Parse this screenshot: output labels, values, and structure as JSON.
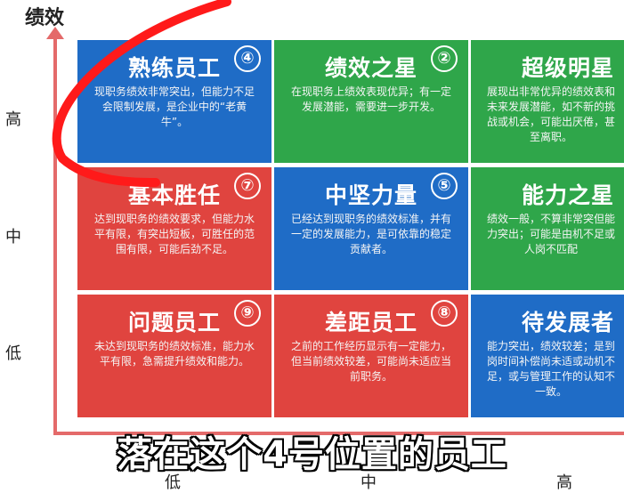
{
  "axis": {
    "y_title": "绩效",
    "row_labels": [
      "高",
      "中",
      "低"
    ],
    "col_labels": [
      "低",
      "中",
      "高"
    ]
  },
  "cells": [
    {
      "number": "④",
      "title": "熟练员工",
      "desc": "现职务绩效非常突出，但能力不足会限制发展，是企业中的“老黄牛”。",
      "color": "blue"
    },
    {
      "number": "②",
      "title": "绩效之星",
      "desc": "在现职务上绩效表现优异；有一定发展潜能，需要进一步开发。",
      "color": "green"
    },
    {
      "number": "",
      "title": "超级明星",
      "desc": "展现出非常优异的绩效表和未来发展潜能，如不新的挑战或机会，可能出厌倦，甚至离职。",
      "color": "green"
    },
    {
      "number": "⑦",
      "title": "基本胜任",
      "desc": "达到现职务的绩效要求，但能力水平有限，有突出短板，可胜任的范围有限，可能后劲不足。",
      "color": "red"
    },
    {
      "number": "⑤",
      "title": "中坚力量",
      "desc": "已经达到现职务的绩效标准，并有一定的发展能力，是可依靠的稳定贡献者。",
      "color": "blue"
    },
    {
      "number": "",
      "title": "能力之星",
      "desc": "绩效一般，不算非常突但能力突出；可能是由机不足或人岗不匹配",
      "color": "green"
    },
    {
      "number": "⑨",
      "title": "问题员工",
      "desc": "未达到现职务的绩效标准，能力水平有限，急需提升绩效和能力。",
      "color": "red"
    },
    {
      "number": "⑧",
      "title": "差距员工",
      "desc": "之前的工作经历显示有一定能力，但当前绩效较差，可能尚未适应当前职务。",
      "color": "red"
    },
    {
      "number": "",
      "title": "待发展者",
      "desc": "能力突出，绩效较差；是到岗时间补偿尚未适或动机不足，或与管理工作的认知不一致。",
      "color": "blue"
    }
  ],
  "caption": "落在这个4号位置的员工",
  "colors": {
    "blue": "#1f6cc6",
    "green": "#2fa64a",
    "red": "#e0443f",
    "annotation": "#ff1a1a"
  }
}
